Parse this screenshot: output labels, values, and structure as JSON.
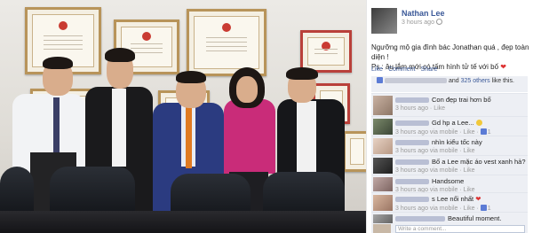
{
  "post": {
    "author": "Nathan Lee",
    "time": "3 hours ago",
    "caption_line1": "Ngưỡng mộ gia đình bác Jonathan quá , đẹp toàn diện !",
    "caption_line2": "Ps : âu lắm mới có tấm hình tử tế với bố",
    "heart": "❤",
    "actions": [
      "Like",
      "Comment",
      "Share"
    ],
    "likes_prefix": "and",
    "likes_link": "325 others",
    "likes_suffix": "like this."
  },
  "comments": [
    {
      "text": "Con đẹp trai hơn bố",
      "meta": "3 hours ago · Like",
      "likes": ""
    },
    {
      "text": "Gd hp a Lee...",
      "meta": "3 hours ago via mobile · Like",
      "likes": "1"
    },
    {
      "text": "nhìn kiểu tốc này",
      "meta": "3 hours ago via mobile · Like",
      "likes": ""
    },
    {
      "text": "Bố a Lee mặc áo vest xanh hả?",
      "meta": "3 hours ago via mobile · Like",
      "likes": ""
    },
    {
      "text": "Handsome",
      "meta": "3 hours ago via mobile · Like",
      "likes": ""
    },
    {
      "text": "s Lee nổi nhất",
      "meta": "3 hours ago via mobile · Like",
      "likes": "1"
    },
    {
      "text": "Beautiful moment.",
      "meta": "",
      "likes": ""
    }
  ],
  "composer": {
    "placeholder": "Write a comment..."
  },
  "colors": {
    "link": "#3b5998",
    "panel": "#edeff4",
    "heart": "#dd3333"
  }
}
